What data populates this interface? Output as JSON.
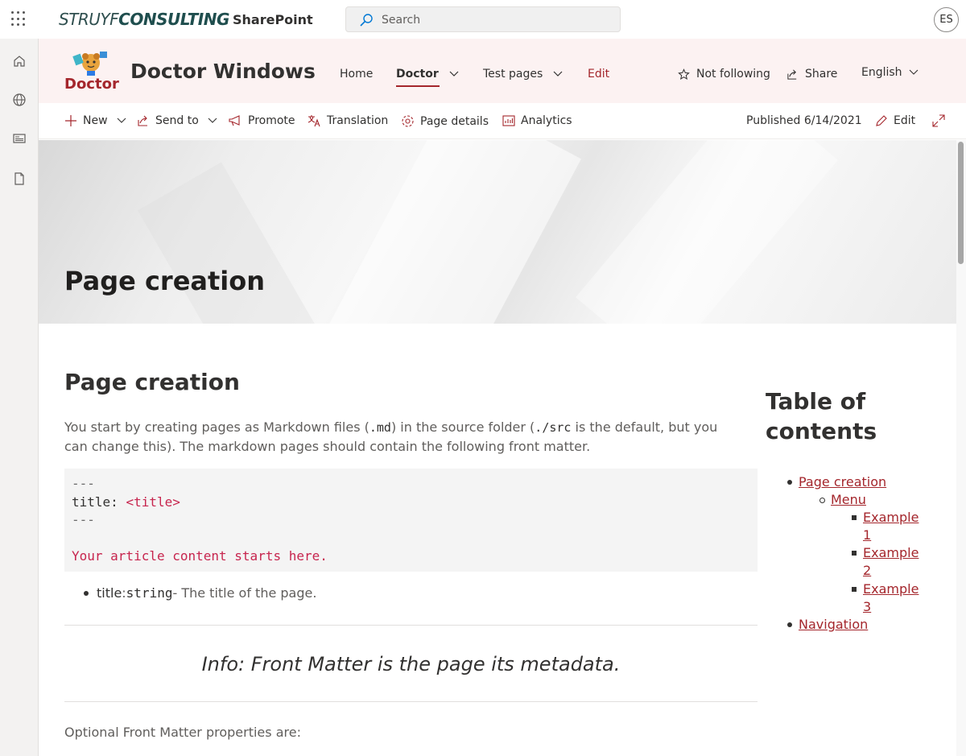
{
  "suitebar": {
    "brand_part1": "STRUYF",
    "brand_part2": "CONSULTING",
    "app_name": "SharePoint",
    "search_placeholder": "Search",
    "user_initials": "ES"
  },
  "site": {
    "logo_caption": "Doctor",
    "title": "Doctor Windows",
    "nav": [
      {
        "label": "Home"
      },
      {
        "label": "Doctor",
        "active": true
      },
      {
        "label": "Test pages"
      },
      {
        "label": "Edit"
      }
    ],
    "actions": {
      "follow": "Not following",
      "share": "Share",
      "language": "English"
    }
  },
  "commandbar": {
    "new": "New",
    "send_to": "Send to",
    "promote": "Promote",
    "translation": "Translation",
    "page_details": "Page details",
    "analytics": "Analytics",
    "published": "Published 6/14/2021",
    "edit": "Edit"
  },
  "hero": {
    "title": "Page creation"
  },
  "article": {
    "heading": "Page creation",
    "intro_1": "You start by creating pages as Markdown files (",
    "intro_code_1": ".md",
    "intro_2": ") in the source folder (",
    "intro_code_2": "./src",
    "intro_3": " is the default, but you can change this). The markdown pages should contain the following front matter.",
    "code": {
      "line1": "---",
      "line2_key": "title: ",
      "line2_val": "<title>",
      "line3": "---",
      "line5": "Your article content starts here."
    },
    "bullet_name": "title",
    "bullet_sep": ": ",
    "bullet_type": "string",
    "bullet_desc": " - The title of the page.",
    "info": "Info: Front Matter is the page its metadata.",
    "optional": "Optional Front Matter properties are:"
  },
  "toc": {
    "title": "Table of contents",
    "items": {
      "page_creation": "Page creation",
      "menu": "Menu",
      "example1": "Example 1",
      "example2": "Example 2",
      "example3": "Example 3",
      "navigation": "Navigation"
    }
  },
  "colors": {
    "accent": "#a4262c",
    "header_bg": "#fcf2f2",
    "code_red": "#c7254e"
  }
}
